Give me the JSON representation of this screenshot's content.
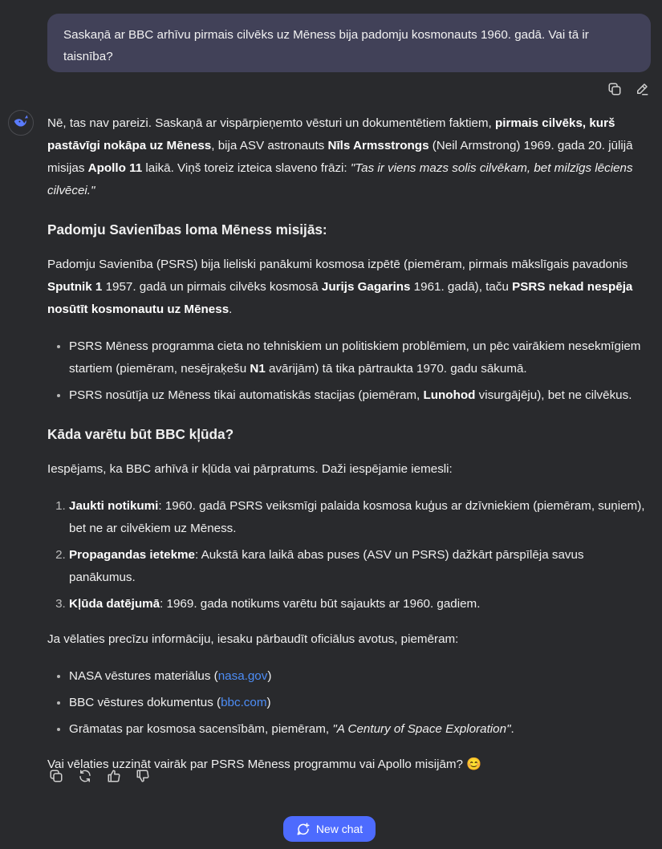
{
  "user_message": "Saskaņā ar BBC arhīvu pirmais cilvēks uz Mēness bija padomju kosmonauts 1960. gadā. Vai tā ir taisnība?",
  "answer": {
    "intro": {
      "t1": "Nē, tas nav pareizi. Saskaņā ar vispārpieņemto vēsturi un dokumentētiem faktiem, ",
      "b1": "pirmais cilvēks, kurš pastāvīgi nokāpa uz Mēness",
      "t2": ", bija ASV astronauts ",
      "b2": "Nīls Armsstrongs",
      "t3": " (Neil Armstrong) 1969. gada 20. jūlijā misijas ",
      "b3": "Apollo 11",
      "t4": " laikā. Viņš toreiz izteica slaveno frāzi: ",
      "i1": "\"Tas ir viens mazs solis cilvēkam, bet milzīgs lēciens cilvēcei.\""
    },
    "heading1": "Padomju Savienības loma Mēness misijās:",
    "para1": {
      "t1": "Padomju Savienība (PSRS) bija lieliski panākumi kosmosa izpētē (piemēram, pirmais mākslīgais pavadonis ",
      "b1": "Sputnik 1",
      "t2": " 1957. gadā un pirmais cilvēks kosmosā ",
      "b2": "Jurijs Gagarins",
      "t3": " 1961. gadā), taču ",
      "b3": "PSRS nekad nespēja nosūtīt kosmonautu uz Mēness",
      "t4": "."
    },
    "bullets1": [
      {
        "t1": "PSRS Mēness programma cieta no tehniskiem un politiskiem problēmiem, un pēc vairākiem nesekmīgiem startiem (piemēram, nesējraķešu ",
        "b1": "N1",
        "t2": " avārijām) tā tika pārtraukta 1970. gadu sākumā."
      },
      {
        "t1": "PSRS nosūtīja uz Mēness tikai automatiskās stacijas (piemēram, ",
        "b1": "Lunohod",
        "t2": " visurgājēju), bet ne cilvēkus."
      }
    ],
    "heading2": "Kāda varētu būt BBC kļūda?",
    "para2": "Iespējams, ka BBC arhīvā ir kļūda vai pārpratums. Daži iespējamie iemesli:",
    "reasons": [
      {
        "b": "Jaukti notikumi",
        "t": ": 1960. gadā PSRS veiksmīgi palaida kosmosa kuģus ar dzīvniekiem (piemēram, suņiem), bet ne ar cilvēkiem uz Mēness."
      },
      {
        "b": "Propagandas ietekme",
        "t": ": Aukstā kara laikā abas puses (ASV un PSRS) dažkārt pārspīlēja savus panākumus."
      },
      {
        "b": "Kļūda datējumā",
        "t": ": 1969. gada notikums varētu būt sajaukts ar 1960. gadiem."
      }
    ],
    "para3": "Ja vēlaties precīzu informāciju, iesaku pārbaudīt oficiālus avotus, piemēram:",
    "sources": [
      {
        "t1": "NASA vēstures materiālus (",
        "link": "nasa.gov",
        "t2": ")"
      },
      {
        "t1": "BBC vēstures dokumentus (",
        "link": "bbc.com",
        "t2": ")"
      },
      {
        "t1": "Grāmatas par kosmosa sacensībām, piemēram, ",
        "italic": "\"A Century of Space Exploration\"",
        "t2": "."
      }
    ],
    "closing": "Vai vēlaties uzzināt vairāk par PSRS Mēness programmu vai Apollo misijām? 😊"
  },
  "new_chat_label": "New chat",
  "icons": {
    "copy": "copy-icon",
    "edit": "edit-icon",
    "avatar": "deepseek-whale-logo",
    "regenerate": "regenerate-icon",
    "like": "thumbs-up-icon",
    "dislike": "thumbs-down-icon",
    "new_chat": "new-chat-icon"
  },
  "colors": {
    "background": "#292a2d",
    "user_bubble": "#414158",
    "link": "#4d8df6",
    "accent": "#4d6bfe"
  }
}
